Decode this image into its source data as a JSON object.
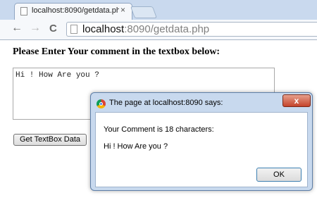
{
  "browser": {
    "tab_title": "localhost:8090/getdata.ph",
    "tab_close": "×",
    "url_host": "localhost",
    "url_rest": ":8090/getdata.php",
    "back_icon": "←",
    "forward_icon": "→",
    "reload_icon": "C"
  },
  "page": {
    "heading": "Please Enter Your comment in the textbox below:",
    "textarea_value": "Hi ! How Are you ?",
    "button_label": "Get TextBox Data"
  },
  "dialog": {
    "title": "The page at localhost:8090 says:",
    "close_label": "x",
    "message_line1": "Your Comment is 18 characters:",
    "message_line2": "Hi ! How Are you ?",
    "ok_label": "OK"
  },
  "colors": {
    "accent": "#c8d9ee",
    "close_button": "#c4432b"
  }
}
